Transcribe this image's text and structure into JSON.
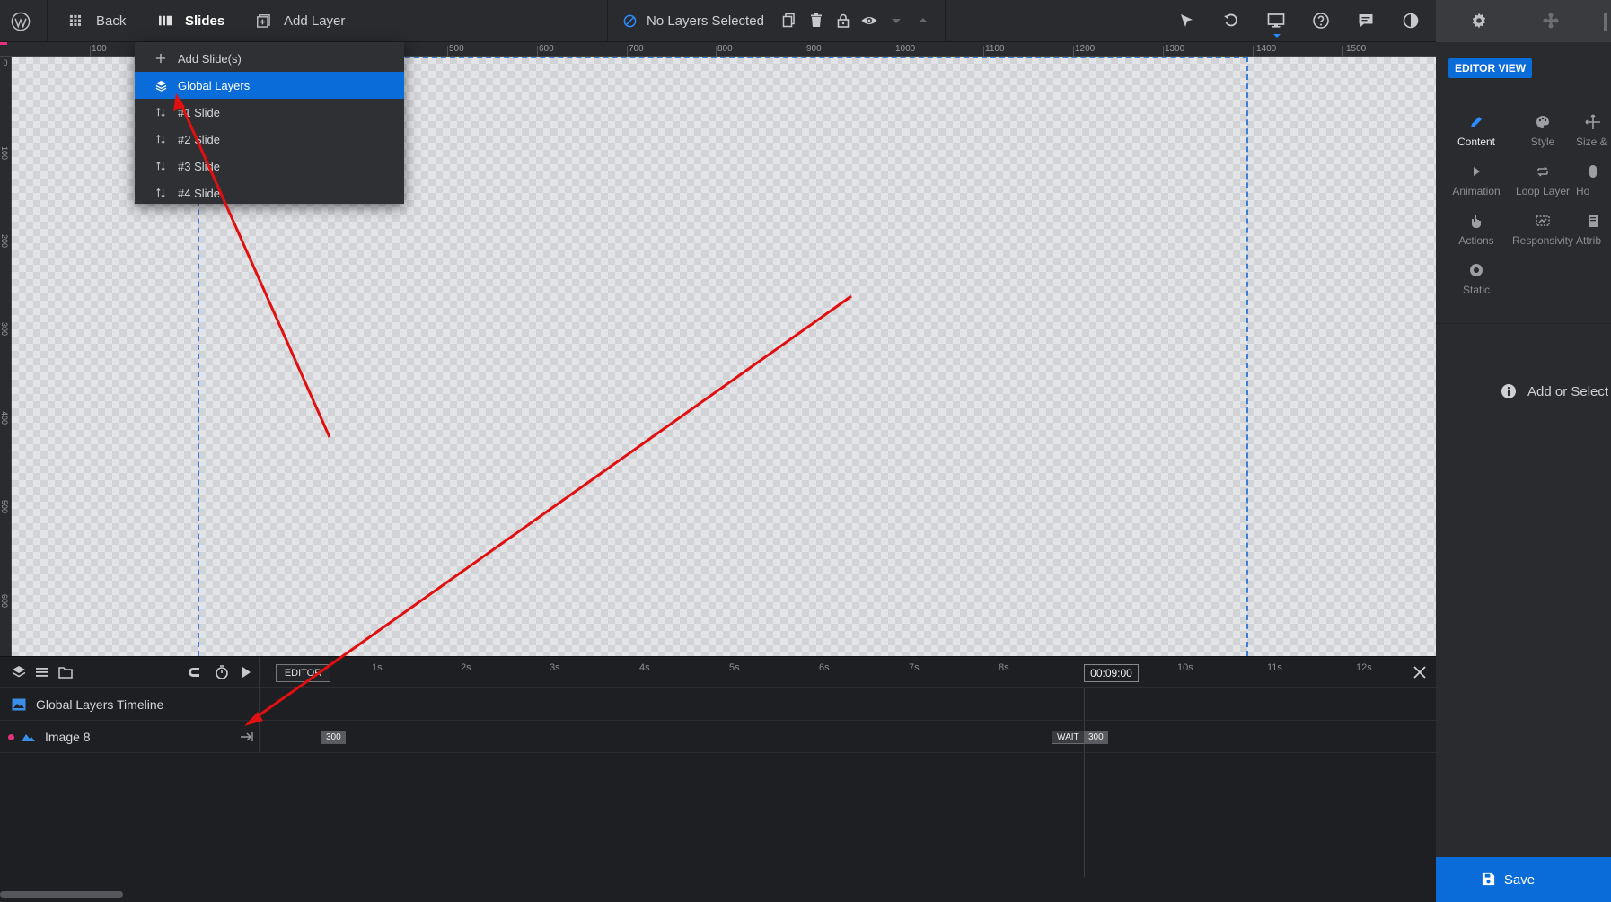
{
  "topbar": {
    "back_label": "Back",
    "slides_label": "Slides",
    "add_layer_label": "Add Layer",
    "layer_status": "No Layers Selected"
  },
  "ruler": {
    "top_ticks": [
      "100",
      "500",
      "600",
      "700",
      "800",
      "900",
      "1000",
      "1100",
      "1200",
      "1300",
      "1400",
      "1500"
    ],
    "left_ticks": [
      "0",
      "100",
      "200",
      "300",
      "400",
      "500",
      "600"
    ]
  },
  "slides_menu": {
    "items": [
      {
        "label": "Add Slide(s)",
        "icon": "plus-icon",
        "active": false
      },
      {
        "label": "Global Layers",
        "icon": "layers-icon",
        "active": true
      },
      {
        "label": "#1 Slide",
        "icon": "sort-icon",
        "active": false
      },
      {
        "label": "#2 Slide",
        "icon": "sort-icon",
        "active": false
      },
      {
        "label": "#3 Slide",
        "icon": "sort-icon",
        "active": false
      },
      {
        "label": "#4 Slide",
        "icon": "sort-icon",
        "active": false
      }
    ]
  },
  "right_panel": {
    "editor_view_label": "EDITOR VIEW",
    "tabs": [
      {
        "label": "Content",
        "icon": "pencil-icon",
        "active": true
      },
      {
        "label": "Style",
        "icon": "palette-icon",
        "active": false
      },
      {
        "label": "Size &",
        "icon": "resize-icon",
        "active": false
      },
      {
        "label": "Animation",
        "icon": "play-icon",
        "active": false
      },
      {
        "label": "Loop Layer",
        "icon": "loop-icon",
        "active": false
      },
      {
        "label": "Ho",
        "icon": "mouse-icon",
        "active": false
      },
      {
        "label": "Actions",
        "icon": "hand-icon",
        "active": false
      },
      {
        "label": "Responsivity",
        "icon": "responsive-icon",
        "active": false
      },
      {
        "label": "Attrib",
        "icon": "attributes-icon",
        "active": false
      },
      {
        "label": "Static",
        "icon": "static-icon",
        "active": false
      }
    ],
    "info_text": "Add or Select",
    "save_label": "Save"
  },
  "timeline": {
    "editor_label": "EDITOR",
    "seconds": [
      "1s",
      "2s",
      "3s",
      "4s",
      "5s",
      "6s",
      "7s",
      "8s",
      "10s",
      "11s",
      "12s"
    ],
    "time_value": "00:09:00",
    "group_label": "Global Layers Timeline",
    "layer_label": "Image 8",
    "start_tag": "300",
    "wait_label": "WAIT",
    "end_tag": "300"
  },
  "colors": {
    "accent": "#0a6cd8",
    "annotation": "#e01010",
    "layer_dot": "#e4317e"
  }
}
